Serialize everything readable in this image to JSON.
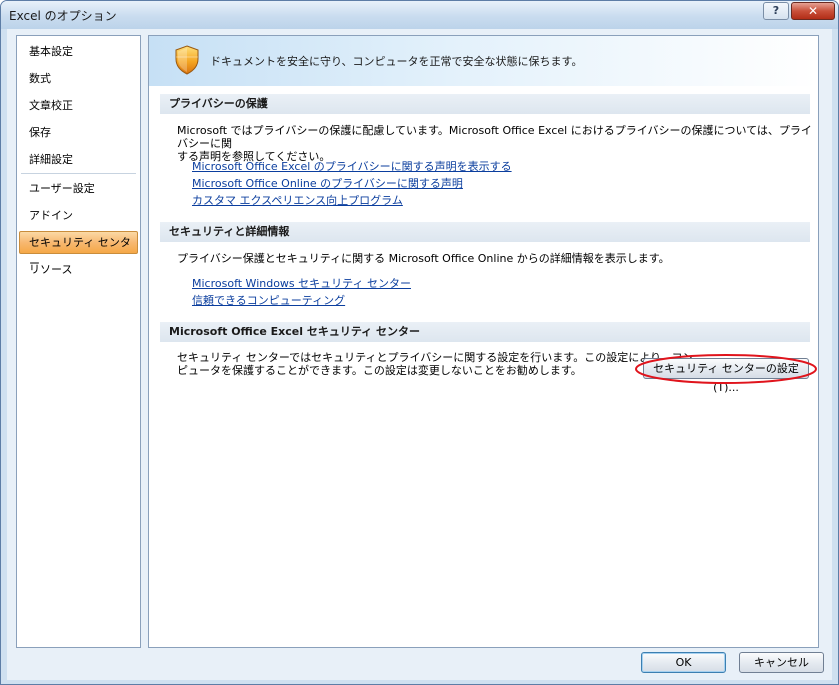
{
  "window": {
    "title": "Excel のオプション",
    "help_label": "?",
    "close_label": "✕"
  },
  "sidebar": {
    "items": [
      {
        "label": "基本設定"
      },
      {
        "label": "数式"
      },
      {
        "label": "文章校正"
      },
      {
        "label": "保存"
      },
      {
        "label": "詳細設定"
      },
      {
        "label": "ユーザー設定"
      },
      {
        "label": "アドイン"
      },
      {
        "label": "セキュリティ センター",
        "selected": true
      },
      {
        "label": "リソース"
      }
    ]
  },
  "banner": {
    "icon": "shield-icon",
    "text": "ドキュメントを安全に守り、コンピュータを正常で安全な状態に保ちます。"
  },
  "sections": {
    "privacy": {
      "title": "プライバシーの保護",
      "paragraph_line1": "Microsoft ではプライバシーの保護に配慮しています。Microsoft Office Excel におけるプライバシーの保護については、プライバシーに関",
      "paragraph_line2": "する声明を参照してください。",
      "links": [
        "Microsoft Office Excel のプライバシーに関する声明を表示する",
        "Microsoft Office Online のプライバシーに関する声明",
        "カスタマ エクスペリエンス向上プログラム"
      ]
    },
    "security": {
      "title": "セキュリティと詳細情報",
      "paragraph": "プライバシー保護とセキュリティに関する Microsoft Office Online からの詳細情報を表示します。",
      "links": [
        "Microsoft Windows セキュリティ センター",
        "信頼できるコンピューティング"
      ]
    },
    "trust_center": {
      "title": "Microsoft Office Excel セキュリティ センター",
      "paragraph_line1": "セキュリティ センターではセキュリティとプライバシーに関する設定を行います。この設定により、コン",
      "paragraph_line2": "ピュータを保護することができます。この設定は変更しないことをお勧めします。",
      "button_label": "セキュリティ センターの設定(T)..."
    }
  },
  "footer": {
    "ok_label": "OK",
    "cancel_label": "キャンセル"
  },
  "colors": {
    "selected_nav": "#f7b871",
    "link": "#0b3e9e",
    "annotation": "#e0141c"
  }
}
